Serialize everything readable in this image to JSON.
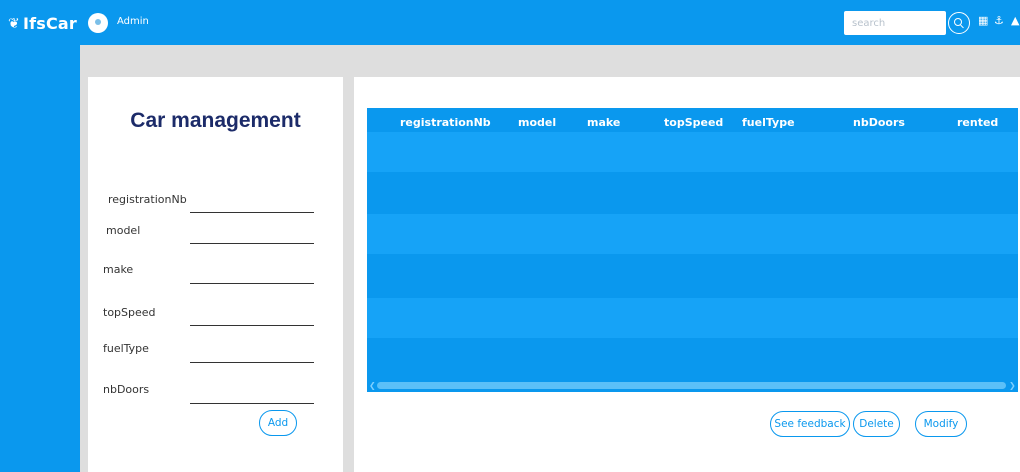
{
  "app": {
    "logo_text": "IfsCar",
    "user_name": "Admin"
  },
  "search": {
    "placeholder": "search"
  },
  "form": {
    "title": "Car management",
    "fields": [
      {
        "label": "registrationNb",
        "value": ""
      },
      {
        "label": "model",
        "value": ""
      },
      {
        "label": "make",
        "value": ""
      },
      {
        "label": "topSpeed",
        "value": ""
      },
      {
        "label": "fuelType",
        "value": ""
      },
      {
        "label": "nbDoors",
        "value": ""
      }
    ],
    "add_label": "Add"
  },
  "table": {
    "columns": [
      "registrationNb",
      "model",
      "make",
      "topSpeed",
      "fuelType",
      "nbDoors",
      "rented"
    ],
    "rows": []
  },
  "actions": {
    "feedback_label": "See feedback",
    "delete_label": "Delete",
    "modify_label": "Modify"
  },
  "colors": {
    "primary": "#0a98ee",
    "title": "#1c2b69",
    "band": "#dedede"
  }
}
